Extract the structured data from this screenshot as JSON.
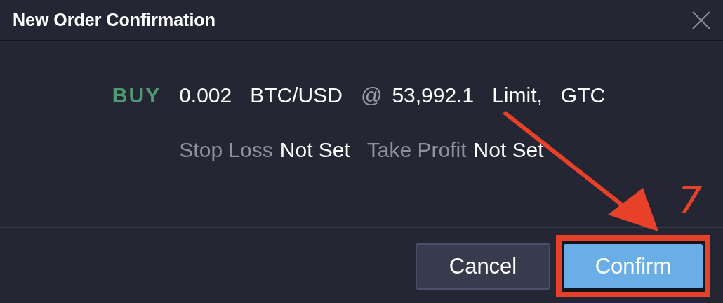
{
  "dialog": {
    "title": "New Order Confirmation"
  },
  "order": {
    "side": "BUY",
    "kind": "buy",
    "quantity": "0.002",
    "pair": "BTC/USD",
    "at": "@",
    "price": "53,992.1",
    "type": "Limit,",
    "tif": "GTC"
  },
  "protection": [
    {
      "label": "Stop Loss",
      "value": "Not Set"
    },
    {
      "label": "Take Profit",
      "value": "Not Set"
    }
  ],
  "buttons": [
    {
      "label": "Cancel",
      "kind": "secondary",
      "highlighted": false
    },
    {
      "label": "Confirm",
      "kind": "primary",
      "highlighted": true
    }
  ],
  "annotation": {
    "label": "7"
  }
}
